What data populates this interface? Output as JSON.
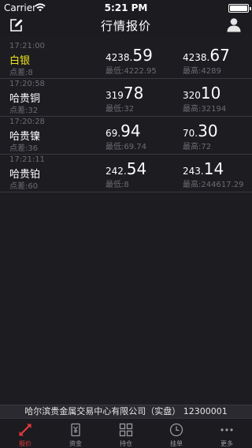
{
  "status_bar": {
    "carrier": "Carrier",
    "time": "5:21 PM"
  },
  "nav": {
    "title": "行情报价"
  },
  "quotes": [
    {
      "time": "17:21:00",
      "name": "白银",
      "spread": "点差:8",
      "buy_small": "4238.",
      "buy_big": "59",
      "low": "最低:4222.95",
      "sell_small": "4238.",
      "sell_big": "67",
      "high": "最高:4289"
    },
    {
      "time": "17:20:58",
      "name": "哈贵铜",
      "spread": "点差:32",
      "buy_small": "319",
      "buy_big": "78",
      "low": "最低:32",
      "sell_small": "320",
      "sell_big": "10",
      "high": "最高:32194"
    },
    {
      "time": "17:20:28",
      "name": "哈贵镍",
      "spread": "点差:36",
      "buy_small": "69.",
      "buy_big": "94",
      "low": "最低:69.74",
      "sell_small": "70.",
      "sell_big": "30",
      "high": "最高:72"
    },
    {
      "time": "17:21:11",
      "name": "哈贵铂",
      "spread": "点差:60",
      "buy_small": "242.",
      "buy_big": "54",
      "low": "最低:8",
      "sell_small": "243.",
      "sell_big": "14",
      "high": "最高:244617.29"
    }
  ],
  "company": {
    "text": "哈尔滨贵金属交易中心有限公司（实盘） 12300001"
  },
  "tabs": [
    {
      "label": "报价",
      "icon": "quote-arrows-icon"
    },
    {
      "label": "资金",
      "icon": "funds-icon"
    },
    {
      "label": "持仓",
      "icon": "positions-grid-icon"
    },
    {
      "label": "挂单",
      "icon": "clock-icon"
    },
    {
      "label": "更多",
      "icon": "more-dots-icon"
    }
  ],
  "colors": {
    "background": "#1c1c21",
    "highlight_name": "#f0e31c",
    "active_tab": "#e53a3a",
    "muted_text": "#6c6c72"
  }
}
